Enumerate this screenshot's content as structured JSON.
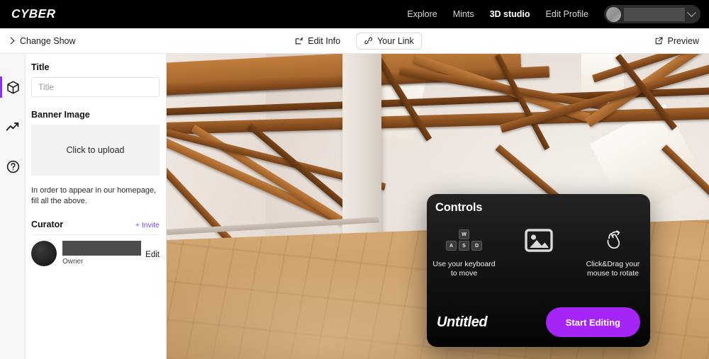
{
  "topbar": {
    "logo": "CYBER",
    "nav": [
      {
        "label": "Explore",
        "active": false
      },
      {
        "label": "Mints",
        "active": false
      },
      {
        "label": "3D studio",
        "active": true
      },
      {
        "label": "Edit Profile",
        "active": false
      }
    ],
    "user": {
      "name_redacted": "",
      "chevron_icon": "chevron-down-icon"
    }
  },
  "subbar": {
    "change_show": "Change Show",
    "edit_info": "Edit Info",
    "your_link": "Your Link",
    "preview": "Preview"
  },
  "rail": {
    "items": [
      {
        "icon": "cube-icon",
        "active": true
      },
      {
        "icon": "trending-up-icon",
        "active": false
      },
      {
        "icon": "help-circle-icon",
        "active": false
      }
    ],
    "accent_color": "#8b2ff0"
  },
  "panel": {
    "title_label": "Title",
    "title_value": "",
    "title_placeholder": "Title",
    "banner_label": "Banner Image",
    "banner_upload_text": "Click to upload",
    "helper_text": "In order to appear in our homepage, fill all the above.",
    "curator_label": "Curator",
    "invite_label": "+ Invite",
    "invite_color": "#7a3ef0",
    "person": {
      "name_redacted": "",
      "role": "Owner",
      "edit_label": "Edit"
    }
  },
  "modal": {
    "title": "Controls",
    "controls": [
      {
        "icon": "wasd-keys-icon",
        "keys_top": [
          "W"
        ],
        "keys_bottom": [
          "A",
          "S",
          "D"
        ],
        "label": "Use your keyboard to move"
      },
      {
        "icon": "image-icon",
        "label": ""
      },
      {
        "icon": "rotate-hand-icon",
        "label": "Click&Drag your mouse to rotate"
      }
    ],
    "show_name": "Untitled",
    "start_button": "Start Editing",
    "start_button_color": "#a525f7"
  },
  "viewport": {
    "scene_name": "3d-gallery-room",
    "description": "wooden roof trusses, white walls, wood plank floor, central column"
  }
}
